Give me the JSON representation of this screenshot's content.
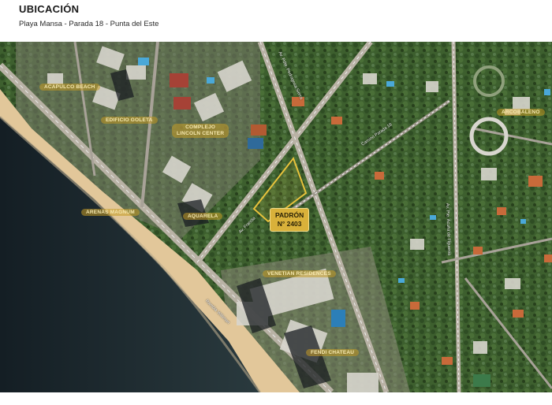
{
  "header": {
    "title": "UBICACIÓN",
    "subtitle": "Playa Mansa - Parada 18 - Punta del Este"
  },
  "map": {
    "labels": {
      "acapulco_beach": "ACAPULCO BEACH",
      "edificio_goleta": "EDIFICIO GOLETA",
      "complejo_lincoln_line1": "COMPLEJO",
      "complejo_lincoln_line2": "LINCOLN CENTER",
      "aquarela": "AQUARELA",
      "arenas_magnum": "ARENAS MAGNUM",
      "venetian_residences": "VENETIAN RESIDENCES",
      "fendi_chateau": "FENDI CHATEAU",
      "arcobaleno": "ARCOBALENO"
    },
    "padron": {
      "line1": "PADRÓN",
      "line2": "N° 2403"
    },
    "roads": {
      "pedragosa": "Av. Pdte. Pedragosa Sierra",
      "francia": "Av. Francia",
      "roosevelt": "Av. Roosevelt",
      "rambla": "Rambla Williman",
      "boulevard": "Boulevard Artigas",
      "camino": "Camino Parada 18",
      "acuna": "Av. Pte. Acuña de Figueroa"
    },
    "colors": {
      "accent": "#d9b13a",
      "label_bg": "#c49a24",
      "sand": "#e2c79a",
      "water": "#1d2c33",
      "vegetation": "#3f6130",
      "road": "#b9b2a5"
    }
  }
}
